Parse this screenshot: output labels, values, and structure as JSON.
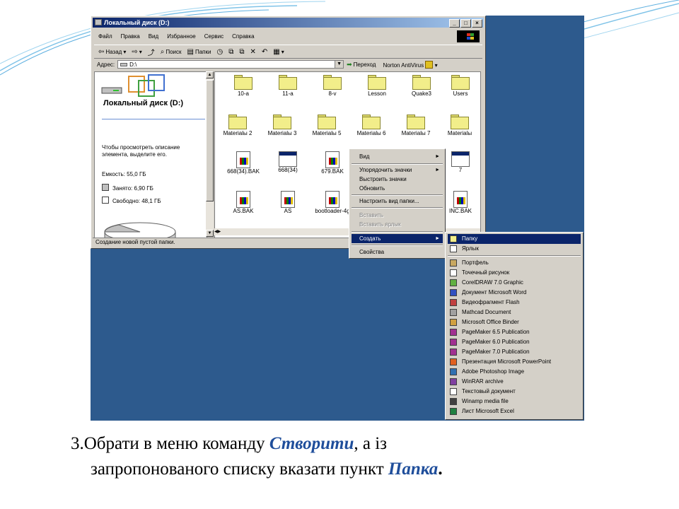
{
  "window": {
    "title": "Локальный диск (D:)",
    "title_buttons": [
      "_",
      "□",
      "×"
    ],
    "menu": [
      "Файл",
      "Правка",
      "Вид",
      "Избранное",
      "Сервис",
      "Справка"
    ],
    "toolbar": {
      "back": "Назад",
      "search": "Поиск",
      "folders": "Папки"
    },
    "address": {
      "label": "Адрес:",
      "value": "D:\\",
      "go": "Переход",
      "antivirus": "Norton AntiVirus"
    },
    "left_pane": {
      "title": "Локальный диск (D:)",
      "hint": "Чтобы просмотреть описание элемента, выделите его.",
      "capacity": "Емкость: 55,0 ГБ",
      "used": "Занято: 6,90 ГБ",
      "free": "Свободно: 48,1 ГБ"
    },
    "items": [
      {
        "name": "10-a",
        "icon": "folder-icon"
      },
      {
        "name": "11-a",
        "icon": "folder-icon"
      },
      {
        "name": "8-v",
        "icon": "folder-icon"
      },
      {
        "name": "Lesson",
        "icon": "folder-icon"
      },
      {
        "name": "Quake3",
        "icon": "folder-icon"
      },
      {
        "name": "Users",
        "icon": "folder-icon"
      },
      {
        "name": "Materialы 2",
        "icon": "folder-icon"
      },
      {
        "name": "Materialы 3",
        "icon": "folder-icon"
      },
      {
        "name": "Materialы 5",
        "icon": "folder-icon"
      },
      {
        "name": "Materialы 6",
        "icon": "folder-icon"
      },
      {
        "name": "Materialы 7",
        "icon": "folder-icon"
      },
      {
        "name": "Materialы",
        "icon": "folder-icon"
      },
      {
        "name": "668(34).BAK",
        "icon": "file-icon"
      },
      {
        "name": "668(34)",
        "icon": "window-icon"
      },
      {
        "name": "679.BAK",
        "icon": "file-icon"
      },
      {
        "name": "7",
        "icon": "window-icon"
      },
      {
        "name": "AS.BAK",
        "icon": "file-icon"
      },
      {
        "name": "AS",
        "icon": "file-icon"
      },
      {
        "name": "bootloader-4g",
        "icon": "file-icon"
      },
      {
        "name": "INC.BAK",
        "icon": "file-icon"
      }
    ],
    "status": "Создание новой пустой папки."
  },
  "context_menu": {
    "view": "Вид",
    "arrange": "Упорядочить значки",
    "align": "Выстроить значки",
    "refresh": "Обновить",
    "customize": "Настроить вид папки...",
    "paste": "Вставить",
    "paste_shortcut": "Вставить ярлык",
    "create": "Создать",
    "properties": "Свойства"
  },
  "submenu": [
    {
      "label": "Папку",
      "icon": "folder-icon",
      "color": "#f2ee8a"
    },
    {
      "label": "Ярлык",
      "icon": "shortcut-icon",
      "color": "#ffffff"
    },
    {
      "label": "Портфель",
      "icon": "briefcase-icon",
      "color": "#c8a860"
    },
    {
      "label": "Точечный рисунок",
      "icon": "bitmap-icon",
      "color": "#ffffff"
    },
    {
      "label": "CorelDRAW 7.0 Graphic",
      "icon": "coreldraw-icon",
      "color": "#60b040"
    },
    {
      "label": "Документ Microsoft Word",
      "icon": "word-icon",
      "color": "#3050c0"
    },
    {
      "label": "Видеофрагмент Flash",
      "icon": "flash-icon",
      "color": "#c04040"
    },
    {
      "label": "Mathcad Document",
      "icon": "mathcad-icon",
      "color": "#a0a0a0"
    },
    {
      "label": "Microsoft Office Binder",
      "icon": "binder-icon",
      "color": "#d0a040"
    },
    {
      "label": "PageMaker 6.5 Publication",
      "icon": "pagemaker-icon",
      "color": "#a03090"
    },
    {
      "label": "PageMaker 6.0 Publication",
      "icon": "pagemaker-icon",
      "color": "#a03090"
    },
    {
      "label": "PageMaker 7.0 Publication",
      "icon": "pagemaker-icon",
      "color": "#a03090"
    },
    {
      "label": "Презентация Microsoft PowerPoint",
      "icon": "powerpoint-icon",
      "color": "#e06020"
    },
    {
      "label": "Adobe Photoshop Image",
      "icon": "photoshop-icon",
      "color": "#3070b0"
    },
    {
      "label": "WinRAR archive",
      "icon": "winrar-icon",
      "color": "#8040a0"
    },
    {
      "label": "Текстовый документ",
      "icon": "text-icon",
      "color": "#ffffff"
    },
    {
      "label": "Winamp media file",
      "icon": "winamp-icon",
      "color": "#404040"
    },
    {
      "label": "Лист Microsoft Excel",
      "icon": "excel-icon",
      "color": "#208040"
    }
  ],
  "caption": {
    "prefix": "3.Обрати в меню команду ",
    "cmd": "Створити",
    "middle": ", а із",
    "line2": "запропонованого списку вказати пункт ",
    "item": "Папка",
    "end": "."
  },
  "colors": {
    "desktop": "#2d5a8d",
    "highlight": "#0a246a",
    "caption_emphasis": "#1f4e9b"
  }
}
